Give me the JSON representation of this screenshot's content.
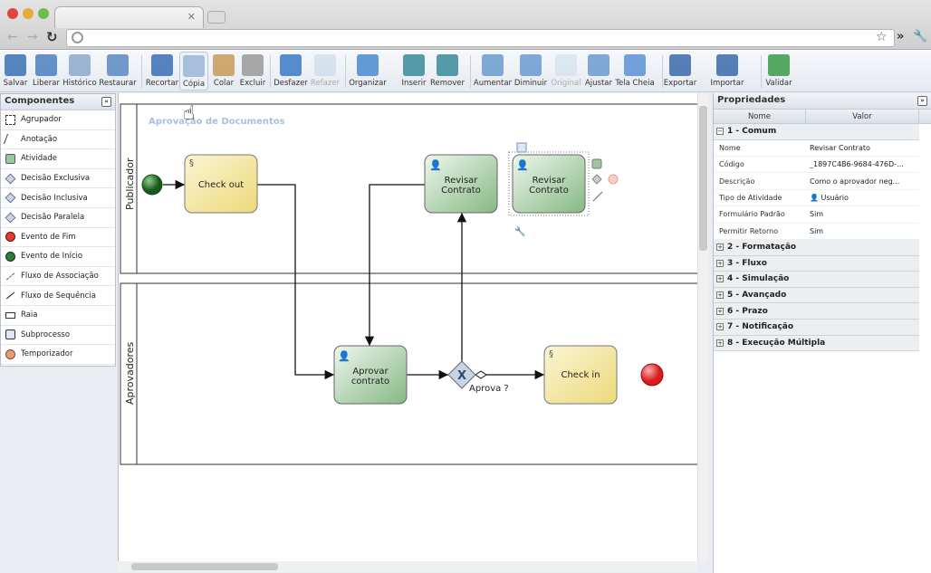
{
  "browser": {
    "colors": {
      "close": "#e0463f",
      "minimize": "#e7a93a",
      "maximize": "#6cbd48"
    }
  },
  "toolbar": {
    "items": [
      {
        "label": "Salvar",
        "icon": "save-icon",
        "enabled": true
      },
      {
        "label": "Liberar",
        "icon": "release-icon",
        "enabled": true
      },
      {
        "label": "Histórico",
        "icon": "history-icon",
        "enabled": true
      },
      {
        "label": "Restaurar",
        "icon": "restore-icon",
        "enabled": true
      },
      {
        "label": "Recortar",
        "icon": "scissors-icon",
        "enabled": true
      },
      {
        "label": "Cópia",
        "icon": "copy-icon",
        "enabled": true
      },
      {
        "label": "Colar",
        "icon": "paste-icon",
        "enabled": true
      },
      {
        "label": "Excluir",
        "icon": "trash-icon",
        "enabled": true
      },
      {
        "label": "Desfazer",
        "icon": "undo-icon",
        "enabled": true
      },
      {
        "label": "Refazer",
        "icon": "redo-icon",
        "enabled": false
      },
      {
        "label": "Organizar",
        "icon": "arrange-icon",
        "enabled": true
      },
      {
        "label": "Inserir",
        "icon": "insert-waypoint-icon",
        "enabled": true
      },
      {
        "label": "Remover",
        "icon": "remove-waypoint-icon",
        "enabled": true
      },
      {
        "label": "Aumentar",
        "icon": "zoom-in-icon",
        "enabled": true
      },
      {
        "label": "Diminuir",
        "icon": "zoom-out-icon",
        "enabled": true
      },
      {
        "label": "Original",
        "icon": "zoom-original-icon",
        "enabled": false
      },
      {
        "label": "Ajustar",
        "icon": "zoom-fit-icon",
        "enabled": true
      },
      {
        "label": "Tela Cheia",
        "icon": "fullscreen-icon",
        "enabled": true
      },
      {
        "label": "Exportar",
        "icon": "export-icon",
        "enabled": true
      },
      {
        "label": "Importar",
        "icon": "import-icon",
        "enabled": true
      },
      {
        "label": "Validar",
        "icon": "validate-icon",
        "enabled": true
      }
    ]
  },
  "components": {
    "title": "Componentes",
    "items": [
      {
        "label": "Agrupador",
        "icon": "group-icon"
      },
      {
        "label": "Anotação",
        "icon": "annotation-icon"
      },
      {
        "label": "Atividade",
        "icon": "activity-icon"
      },
      {
        "label": "Decisão Exclusiva",
        "icon": "exclusive-gateway-icon"
      },
      {
        "label": "Decisão Inclusiva",
        "icon": "inclusive-gateway-icon"
      },
      {
        "label": "Decisão Paralela",
        "icon": "parallel-gateway-icon"
      },
      {
        "label": "Evento de Fim",
        "icon": "end-event-icon"
      },
      {
        "label": "Evento de Início",
        "icon": "start-event-icon"
      },
      {
        "label": "Fluxo de Associação",
        "icon": "association-flow-icon"
      },
      {
        "label": "Fluxo de Sequência",
        "icon": "sequence-flow-icon"
      },
      {
        "label": "Raia",
        "icon": "lane-icon"
      },
      {
        "label": "Subprocesso",
        "icon": "subprocess-icon"
      },
      {
        "label": "Temporizador",
        "icon": "timer-icon"
      }
    ]
  },
  "diagram": {
    "title": "Aprovação de Documentos",
    "lanes": [
      "Publicador",
      "Aprovadores"
    ],
    "tasks": {
      "checkout": "Check out",
      "revisar1": [
        "Revisar",
        "Contrato"
      ],
      "revisar2": [
        "Revisar",
        "Contrato"
      ],
      "aprovar": [
        "Aprovar",
        "contrato"
      ],
      "checkin": "Check in"
    },
    "gateway_label": "Aprova ?",
    "colors": {
      "script_task": "#f2e39a",
      "user_task": "#9cc79a",
      "start": "#2e7d32",
      "end": "#e53935"
    }
  },
  "properties": {
    "title": "Propriedades",
    "columns": [
      "Nome",
      "Valor"
    ],
    "groups": [
      {
        "label": "1 - Comum",
        "expanded": true,
        "rows": [
          {
            "name": "Nome",
            "value": "Revisar Contrato"
          },
          {
            "name": "Código",
            "value": "_1897C4B6-9684-476D-..."
          },
          {
            "name": "Descrição",
            "value": "Como o aprovador neg..."
          },
          {
            "name": "Tipo de Atividade",
            "value": "Usuário"
          },
          {
            "name": "Formulário Padrão",
            "value": "Sim"
          },
          {
            "name": "Permitir Retorno",
            "value": "Sim"
          }
        ]
      },
      {
        "label": "2 - Formatação"
      },
      {
        "label": "3 - Fluxo"
      },
      {
        "label": "4 - Simulação"
      },
      {
        "label": "5 - Avançado"
      },
      {
        "label": "6 - Prazo"
      },
      {
        "label": "7 - Notificação"
      },
      {
        "label": "8 - Execução Múltipla"
      }
    ]
  }
}
